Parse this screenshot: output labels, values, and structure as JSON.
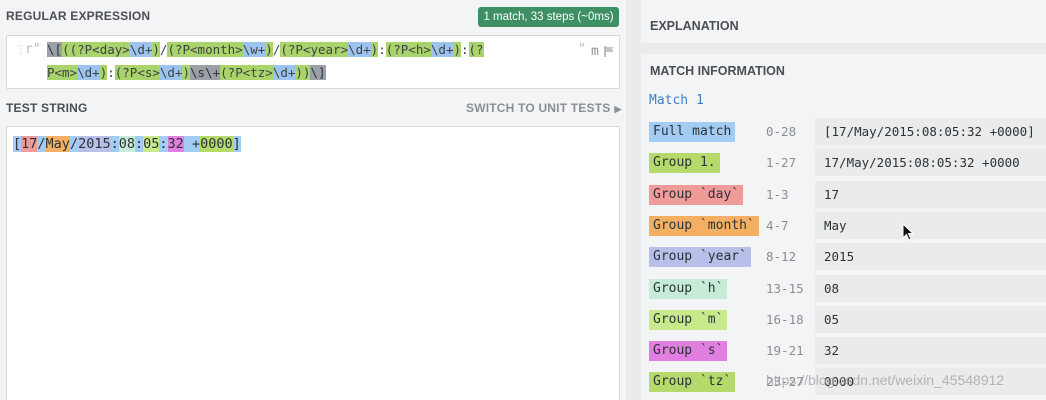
{
  "regex_section": {
    "title": "REGULAR EXPRESSION",
    "status_badge": "1 match, 33 steps (~0ms)",
    "open_delimiter": "r\"",
    "close_delimiter": "\"",
    "flags": "m",
    "line1": [
      {
        "t": "\\[",
        "c": "dark"
      },
      {
        "t": "(",
        "c": "green"
      },
      {
        "t": "(?P<day>",
        "c": "green"
      },
      {
        "t": "\\d+",
        "c": "blue"
      },
      {
        "t": ")",
        "c": "green"
      },
      {
        "t": "/",
        "c": "plain"
      },
      {
        "t": "(?P<month>",
        "c": "green"
      },
      {
        "t": "\\w+",
        "c": "blue"
      },
      {
        "t": ")",
        "c": "green"
      },
      {
        "t": "/",
        "c": "plain"
      },
      {
        "t": "(?P<year>",
        "c": "green"
      },
      {
        "t": "\\d+",
        "c": "blue"
      },
      {
        "t": ")",
        "c": "green"
      },
      {
        "t": ":",
        "c": "plain"
      },
      {
        "t": "(?P<h>",
        "c": "green"
      },
      {
        "t": "\\d+",
        "c": "blue"
      },
      {
        "t": ")",
        "c": "green"
      },
      {
        "t": ":",
        "c": "plain"
      },
      {
        "t": "(?",
        "c": "green"
      }
    ],
    "line2": [
      {
        "t": "P<m>",
        "c": "green"
      },
      {
        "t": "\\d+",
        "c": "blue"
      },
      {
        "t": ")",
        "c": "green"
      },
      {
        "t": ":",
        "c": "plain"
      },
      {
        "t": "(?P<s>",
        "c": "green"
      },
      {
        "t": "\\d+",
        "c": "blue"
      },
      {
        "t": ")",
        "c": "green"
      },
      {
        "t": "\\s",
        "c": "dark"
      },
      {
        "t": "\\+",
        "c": "dark"
      },
      {
        "t": "(?P<tz>",
        "c": "green"
      },
      {
        "t": "\\d+",
        "c": "blue"
      },
      {
        "t": "))",
        "c": "green"
      },
      {
        "t": "\\]",
        "c": "dark"
      }
    ]
  },
  "test_section": {
    "title": "TEST STRING",
    "switch_label": "SWITCH TO UNIT TESTS",
    "segments": [
      {
        "t": "[",
        "c": "full"
      },
      {
        "t": "17",
        "c": "day"
      },
      {
        "t": "/",
        "c": "full"
      },
      {
        "t": "May",
        "c": "month"
      },
      {
        "t": "/",
        "c": "full"
      },
      {
        "t": "2015",
        "c": "year"
      },
      {
        "t": ":",
        "c": "full"
      },
      {
        "t": "08",
        "c": "h"
      },
      {
        "t": ":",
        "c": "full"
      },
      {
        "t": "05",
        "c": "m"
      },
      {
        "t": ":",
        "c": "full"
      },
      {
        "t": "32",
        "c": "s"
      },
      {
        "t": " +",
        "c": "full"
      },
      {
        "t": "0000",
        "c": "tz"
      },
      {
        "t": "]",
        "c": "full"
      }
    ]
  },
  "explanation": {
    "title": "EXPLANATION"
  },
  "match_info": {
    "title": "MATCH INFORMATION",
    "match_title": "Match 1",
    "rows": [
      {
        "label": "Full match",
        "range": "0-28",
        "value": "[17/May/2015:08:05:32 +0000]",
        "color": "#a3ccf2"
      },
      {
        "label": "Group 1.",
        "range": "1-27",
        "value": "17/May/2015:08:05:32 +0000",
        "color": "#b5d96a"
      },
      {
        "label": "Group `day`",
        "range": "1-3",
        "value": "17",
        "color": "#ef9c98"
      },
      {
        "label": "Group `month`",
        "range": "4-7",
        "value": "May",
        "color": "#f4b062"
      },
      {
        "label": "Group `year`",
        "range": "8-12",
        "value": "2015",
        "color": "#b8bfe8"
      },
      {
        "label": "Group `h`",
        "range": "13-15",
        "value": "08",
        "color": "#c6ecd8"
      },
      {
        "label": "Group `m`",
        "range": "16-18",
        "value": "05",
        "color": "#c9ea8c"
      },
      {
        "label": "Group `s`",
        "range": "19-21",
        "value": "32",
        "color": "#e07fe0"
      },
      {
        "label": "Group `tz`",
        "range": "23-27",
        "value": "0000",
        "color": "#b5d96a"
      }
    ]
  },
  "watermark": "https://blog.csdn.net/weixin_45548912"
}
